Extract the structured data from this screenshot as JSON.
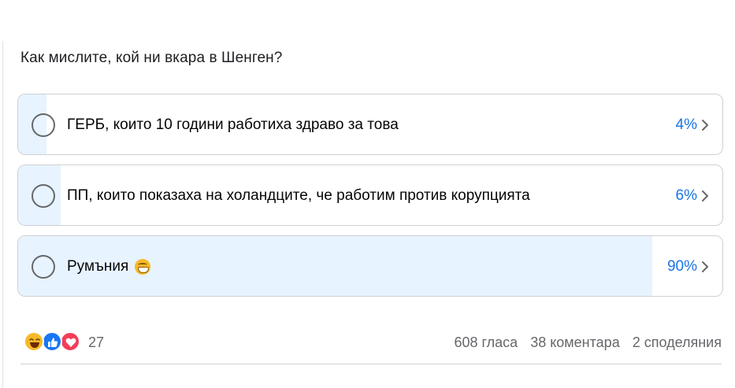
{
  "poll": {
    "question": "Как мислите, кой ни вкара в Шенген?",
    "options": [
      {
        "label": "ГЕРБ, които 10 години работиха здраво за това",
        "percent_label": "4%",
        "share": 0.04
      },
      {
        "label": "ПП, които показаха на холандците, че работим против корупцията",
        "percent_label": "6%",
        "share": 0.06
      },
      {
        "label": "Румъния",
        "percent_label": "90%",
        "share": 0.9,
        "emoji": "grinning-face-emoji"
      }
    ]
  },
  "footer": {
    "reaction_icons": [
      "haha-reaction-icon",
      "like-reaction-icon",
      "love-reaction-icon"
    ],
    "reaction_count": "27",
    "votes": "608 гласа",
    "comments": "38 коментара",
    "shares": "2 споделяния"
  },
  "colors": {
    "accent": "#1b74e4",
    "bar_fill": "#e7f3ff",
    "border": "#ced0d4",
    "muted_text": "#65676b"
  }
}
